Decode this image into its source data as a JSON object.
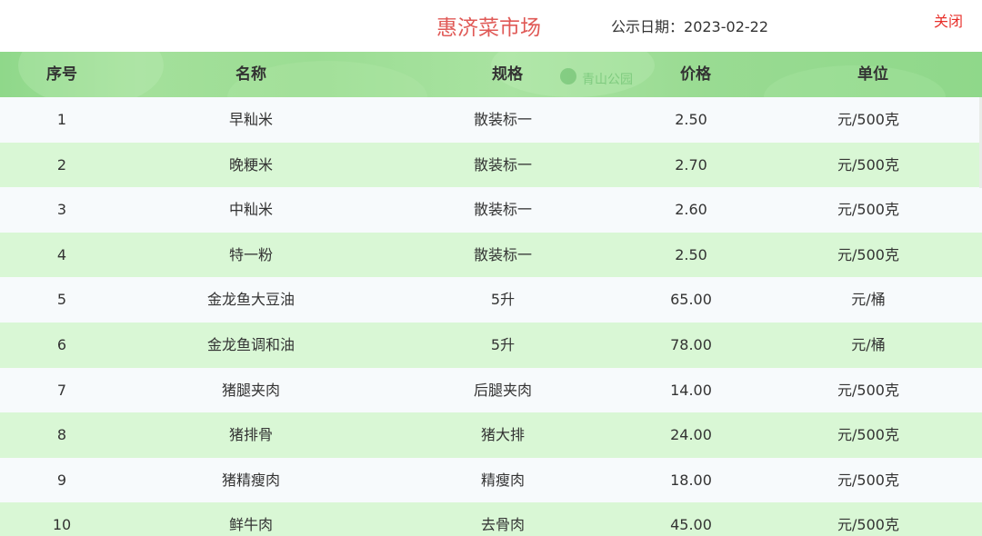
{
  "header": {
    "market_name": "惠济菜市场",
    "date_label": "公示日期：",
    "date_value": "2023-02-22",
    "close_label": "关闭"
  },
  "table": {
    "background_text": "青山公园",
    "columns": [
      "序号",
      "名称",
      "规格",
      "价格",
      "单位"
    ],
    "rows": [
      {
        "no": "1",
        "name": "早籼米",
        "spec": "散装标一",
        "price": "2.50",
        "unit": "元/500克"
      },
      {
        "no": "2",
        "name": "晚粳米",
        "spec": "散装标一",
        "price": "2.70",
        "unit": "元/500克"
      },
      {
        "no": "3",
        "name": "中籼米",
        "spec": "散装标一",
        "price": "2.60",
        "unit": "元/500克"
      },
      {
        "no": "4",
        "name": "特一粉",
        "spec": "散装标一",
        "price": "2.50",
        "unit": "元/500克"
      },
      {
        "no": "5",
        "name": "金龙鱼大豆油",
        "spec": "5升",
        "price": "65.00",
        "unit": "元/桶"
      },
      {
        "no": "6",
        "name": "金龙鱼调和油",
        "spec": "5升",
        "price": "78.00",
        "unit": "元/桶"
      },
      {
        "no": "7",
        "name": "猪腿夹肉",
        "spec": "后腿夹肉",
        "price": "14.00",
        "unit": "元/500克"
      },
      {
        "no": "8",
        "name": "猪排骨",
        "spec": "猪大排",
        "price": "24.00",
        "unit": "元/500克"
      },
      {
        "no": "9",
        "name": "猪精瘦肉",
        "spec": "精瘦肉",
        "price": "18.00",
        "unit": "元/500克"
      },
      {
        "no": "10",
        "name": "鲜牛肉",
        "spec": "去骨肉",
        "price": "45.00",
        "unit": "元/500克"
      }
    ]
  },
  "colors": {
    "title": "#e05a57",
    "close": "#e8312c",
    "header_green": "#9bdd93",
    "row_light": "#f7fafc",
    "row_green": "#d9f7d5"
  }
}
